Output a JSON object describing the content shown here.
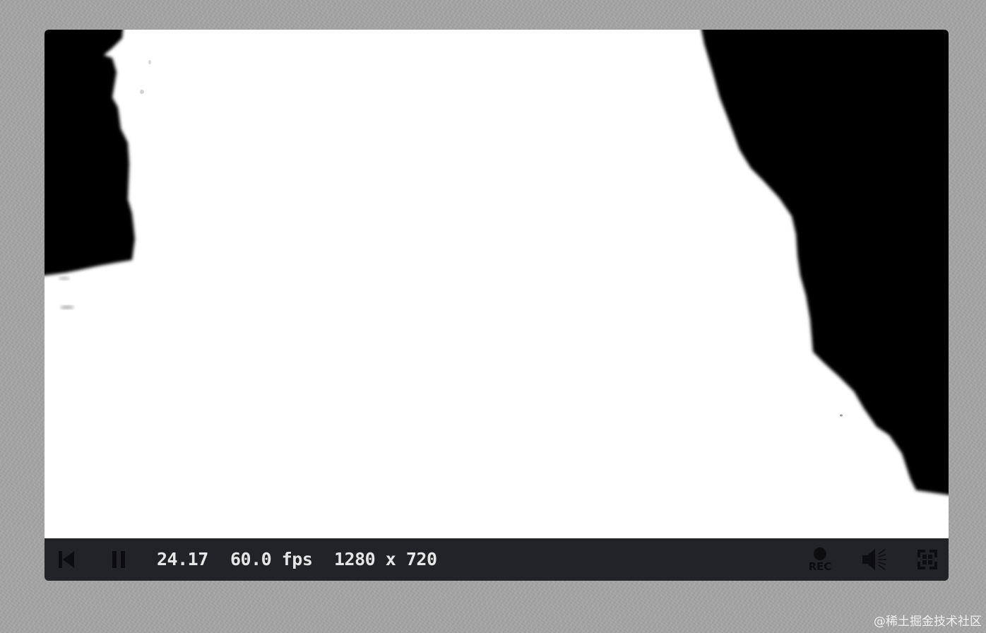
{
  "player": {
    "time": "24.17",
    "fps": "60.0 fps",
    "resolution": "1280 x 720",
    "rec_label": "REC"
  },
  "controls": {
    "rewind_icon": "skip-to-start-icon",
    "pause_icon": "pause-icon",
    "record_icon": "record-icon",
    "volume_icon": "volume-icon",
    "fullscreen_icon": "fullscreen-icon"
  },
  "colors": {
    "control_bar": "#222326",
    "control_text": "#e6e6e6",
    "icon_dark": "#0d0d0f",
    "canvas_light": "#ffffff",
    "canvas_dark": "#000000"
  },
  "watermark": "@稀土掘金技术社区"
}
